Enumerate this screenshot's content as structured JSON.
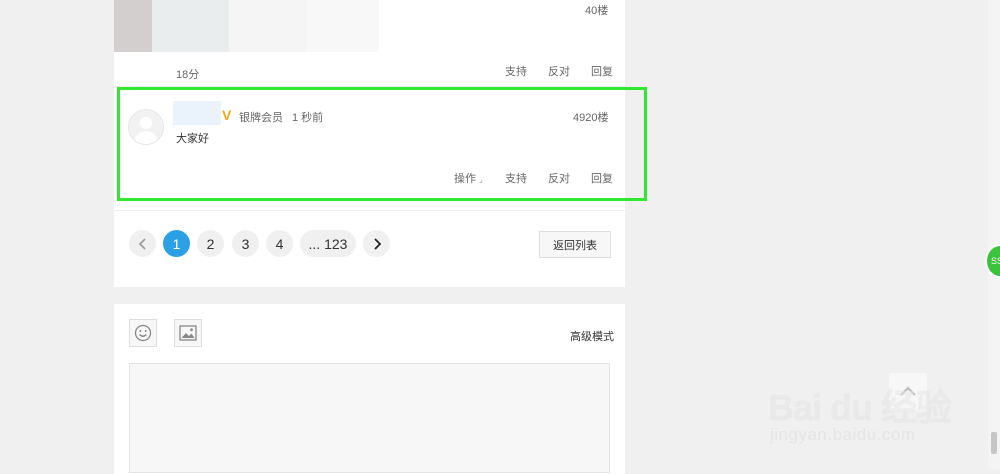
{
  "previous_post": {
    "floor": "40楼",
    "time": "18分",
    "actions": {
      "support": "支持",
      "oppose": "反对",
      "reply": "回复"
    }
  },
  "post": {
    "member_level": "银牌会员",
    "time": "1 秒前",
    "floor": "4920楼",
    "content": "大家好",
    "actions": {
      "operate": "操作",
      "support": "支持",
      "oppose": "反对",
      "reply": "回复"
    }
  },
  "pagination": {
    "pages": [
      "1",
      "2",
      "3",
      "4"
    ],
    "last_page": "... 123",
    "back_to_list": "返回列表"
  },
  "editor": {
    "advanced_mode": "高级模式"
  },
  "side_badge": "SS",
  "watermark": {
    "main": "Bai du 经验",
    "sub": "jingyan.baidu.com"
  },
  "colors": {
    "accent": "#2ca0e6",
    "highlight": "#2fe82f",
    "vip": "#f5a623"
  }
}
